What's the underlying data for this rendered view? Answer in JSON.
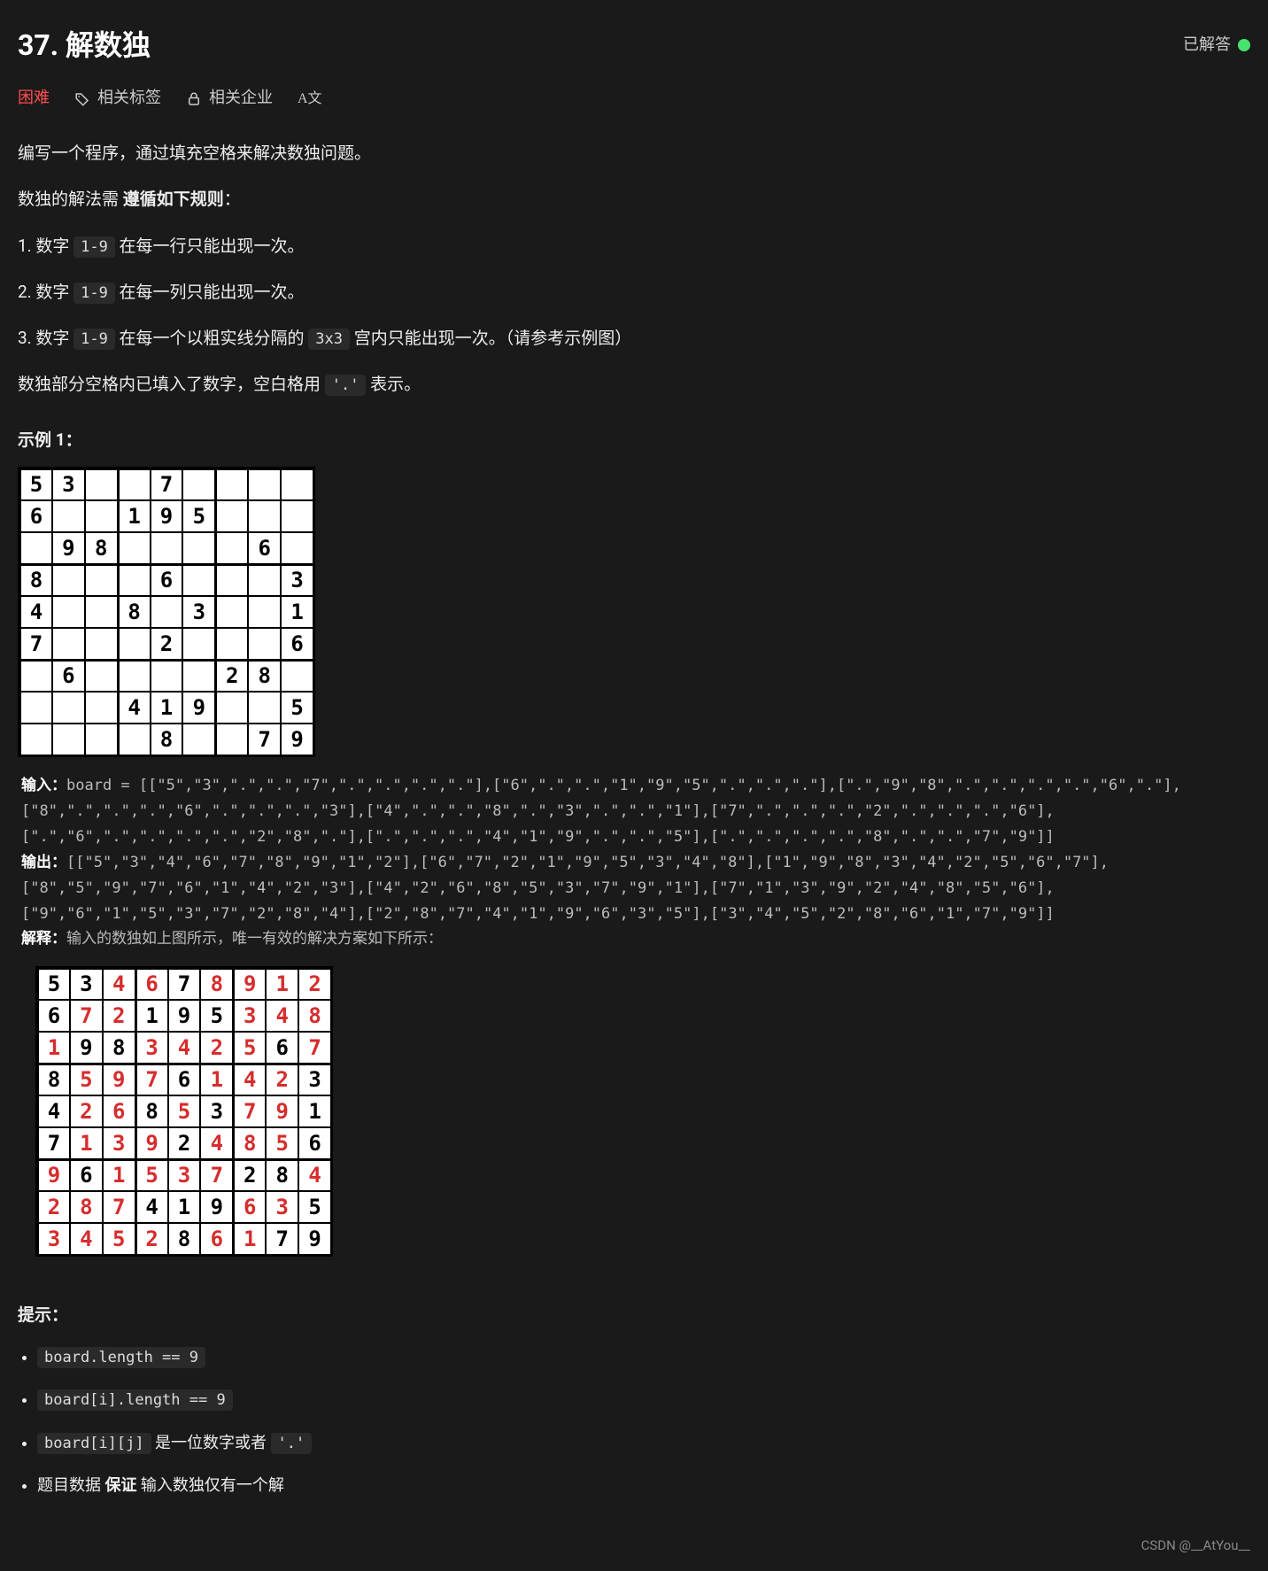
{
  "header": {
    "title": "37. 解数独",
    "solved_label": "已解答"
  },
  "tabs": {
    "difficulty": "困难",
    "tags": "相关标签",
    "companies": "相关企业",
    "lang": "A文"
  },
  "desc": {
    "p1": "编写一个程序，通过填充空格来解决数独问题。",
    "p2a": "数独的解法需 ",
    "p2b": "遵循如下规则",
    "p2c": "：",
    "r1a": "1. 数字 ",
    "r1code": "1-9",
    "r1b": " 在每一行只能出现一次。",
    "r2a": "2. 数字 ",
    "r2code": "1-9",
    "r2b": " 在每一列只能出现一次。",
    "r3a": "3. 数字 ",
    "r3code": "1-9",
    "r3b": " 在每一个以粗实线分隔的 ",
    "r3code2": "3x3",
    "r3c": " 宫内只能出现一次。（请参考示例图）",
    "p3a": "数独部分空格内已填入了数字，空白格用 ",
    "p3code": "'.'",
    "p3b": " 表示。"
  },
  "example": {
    "title": "示例 1：",
    "input_label": "输入：",
    "input_text": "board = [[\"5\",\"3\",\".\",\".\",\"7\",\".\",\".\",\".\",\".\"],[\"6\",\".\",\".\",\"1\",\"9\",\"5\",\".\",\".\",\".\"],[\".\",\"9\",\"8\",\".\",\".\",\".\",\".\",\"6\",\".\"],[\"8\",\".\",\".\",\".\",\"6\",\".\",\".\",\".\",\"3\"],[\"4\",\".\",\".\",\"8\",\".\",\"3\",\".\",\".\",\"1\"],[\"7\",\".\",\".\",\".\",\"2\",\".\",\".\",\".\",\"6\"],[\".\",\"6\",\".\",\".\",\".\",\".\",\"2\",\"8\",\".\"],[\".\",\".\",\".\",\"4\",\"1\",\"9\",\".\",\".\",\"5\"],[\".\",\".\",\".\",\".\",\"8\",\".\",\".\",\"7\",\"9\"]]",
    "output_label": "输出：",
    "output_text": "[[\"5\",\"3\",\"4\",\"6\",\"7\",\"8\",\"9\",\"1\",\"2\"],[\"6\",\"7\",\"2\",\"1\",\"9\",\"5\",\"3\",\"4\",\"8\"],[\"1\",\"9\",\"8\",\"3\",\"4\",\"2\",\"5\",\"6\",\"7\"],[\"8\",\"5\",\"9\",\"7\",\"6\",\"1\",\"4\",\"2\",\"3\"],[\"4\",\"2\",\"6\",\"8\",\"5\",\"3\",\"7\",\"9\",\"1\"],[\"7\",\"1\",\"3\",\"9\",\"2\",\"4\",\"8\",\"5\",\"6\"],[\"9\",\"6\",\"1\",\"5\",\"3\",\"7\",\"2\",\"8\",\"4\"],[\"2\",\"8\",\"7\",\"4\",\"1\",\"9\",\"6\",\"3\",\"5\"],[\"3\",\"4\",\"5\",\"2\",\"8\",\"6\",\"1\",\"7\",\"9\"]]",
    "explain_label": "解释：",
    "explain_text": "输入的数独如上图所示，唯一有效的解决方案如下所示：",
    "board_input": [
      [
        "5",
        "3",
        ".",
        ".",
        "7",
        ".",
        ".",
        ".",
        "."
      ],
      [
        "6",
        ".",
        ".",
        "1",
        "9",
        "5",
        ".",
        ".",
        "."
      ],
      [
        ".",
        "9",
        "8",
        ".",
        ".",
        ".",
        ".",
        "6",
        "."
      ],
      [
        "8",
        ".",
        ".",
        ".",
        "6",
        ".",
        ".",
        ".",
        "3"
      ],
      [
        "4",
        ".",
        ".",
        "8",
        ".",
        "3",
        ".",
        ".",
        "1"
      ],
      [
        "7",
        ".",
        ".",
        ".",
        "2",
        ".",
        ".",
        ".",
        "6"
      ],
      [
        ".",
        "6",
        ".",
        ".",
        ".",
        ".",
        "2",
        "8",
        "."
      ],
      [
        ".",
        ".",
        ".",
        "4",
        "1",
        "9",
        ".",
        ".",
        "5"
      ],
      [
        ".",
        ".",
        ".",
        ".",
        "8",
        ".",
        ".",
        "7",
        "9"
      ]
    ],
    "board_output": [
      [
        "5",
        "3",
        "4",
        "6",
        "7",
        "8",
        "9",
        "1",
        "2"
      ],
      [
        "6",
        "7",
        "2",
        "1",
        "9",
        "5",
        "3",
        "4",
        "8"
      ],
      [
        "1",
        "9",
        "8",
        "3",
        "4",
        "2",
        "5",
        "6",
        "7"
      ],
      [
        "8",
        "5",
        "9",
        "7",
        "6",
        "1",
        "4",
        "2",
        "3"
      ],
      [
        "4",
        "2",
        "6",
        "8",
        "5",
        "3",
        "7",
        "9",
        "1"
      ],
      [
        "7",
        "1",
        "3",
        "9",
        "2",
        "4",
        "8",
        "5",
        "6"
      ],
      [
        "9",
        "6",
        "1",
        "5",
        "3",
        "7",
        "2",
        "8",
        "4"
      ],
      [
        "2",
        "8",
        "7",
        "4",
        "1",
        "9",
        "6",
        "3",
        "5"
      ],
      [
        "3",
        "4",
        "5",
        "2",
        "8",
        "6",
        "1",
        "7",
        "9"
      ]
    ]
  },
  "hints": {
    "title": "提示：",
    "items": [
      {
        "code": "board.length == 9",
        "text": ""
      },
      {
        "code": "board[i].length == 9",
        "text": ""
      },
      {
        "code": "board[i][j]",
        "text": " 是一位数字或者 ",
        "code2": "'.'"
      },
      {
        "pre": "题目数据 ",
        "bold": "保证",
        "post": " 输入数独仅有一个解"
      }
    ]
  },
  "watermark": "CSDN @__AtYou__"
}
